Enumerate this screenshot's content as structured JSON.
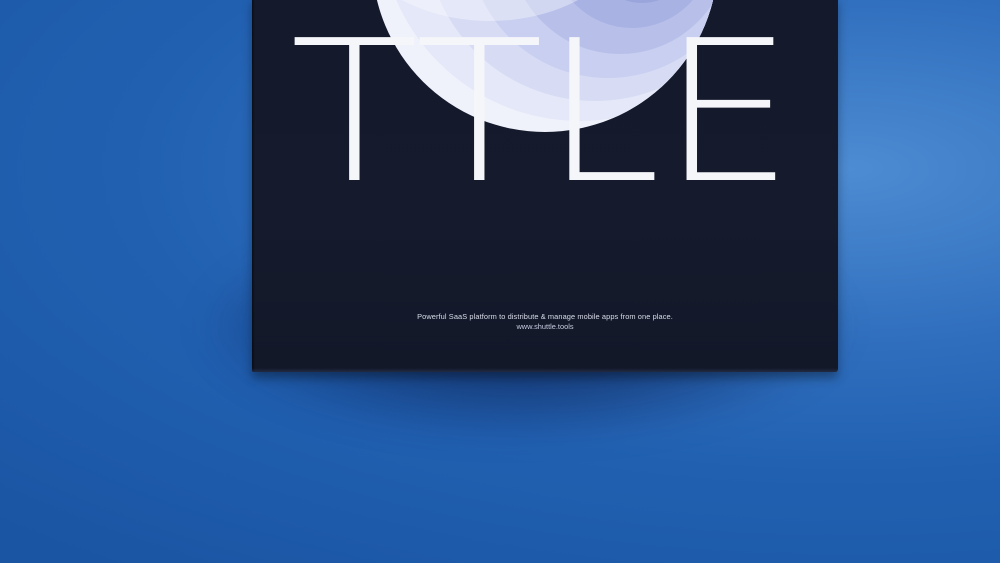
{
  "scene": {
    "background_color": "#2a66b5",
    "poster_color": "#151b2c",
    "orb_colors": [
      "#eef0fb",
      "#d5daf3",
      "#b9c1ea",
      "#9ea8dd"
    ]
  },
  "poster": {
    "headline": "TTLE",
    "tagline": "Powerful SaaS platform to distribute & manage mobile apps from one place.",
    "url": "www.shuttle.tools"
  }
}
